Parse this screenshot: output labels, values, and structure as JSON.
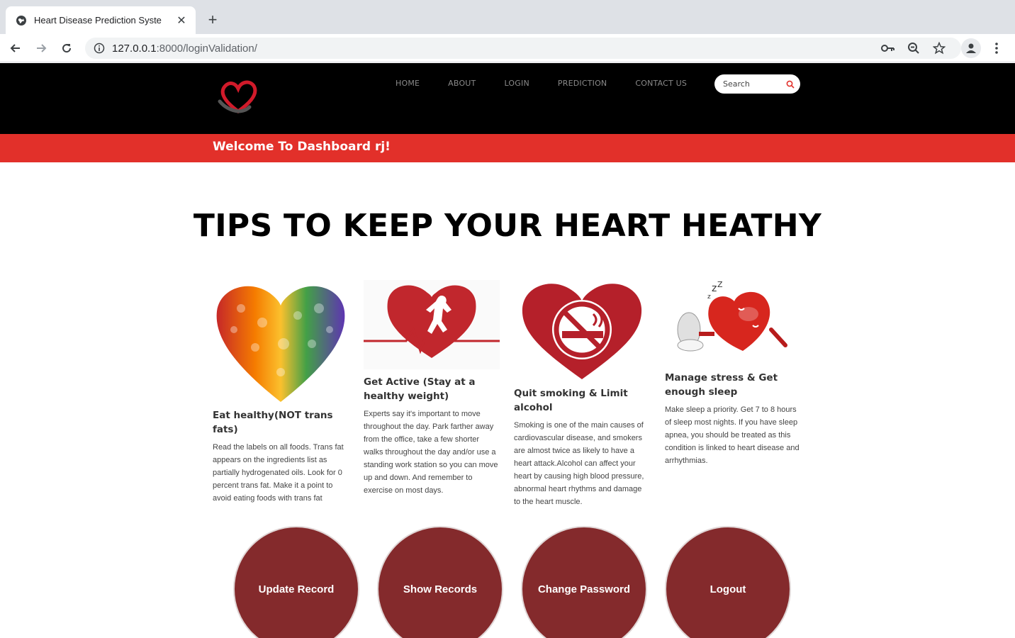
{
  "browser": {
    "tab_title": "Heart Disease Prediction Syste",
    "url_host": "127.0.0.1",
    "url_path": ":8000/loginValidation/"
  },
  "header": {
    "nav": [
      "HOME",
      "ABOUT",
      "LOGIN",
      "PREDICTION",
      "CONTACT US"
    ],
    "search_placeholder": "Search",
    "welcome": "Welcome To Dashboard rj!"
  },
  "main": {
    "title": "TIPS TO KEEP YOUR HEART HEATHY",
    "tips": [
      {
        "title": "Eat healthy(NOT trans fats)",
        "body": "Read the labels on all foods. Trans fat appears on the ingredients list as partially hydrogenated oils. Look for 0 percent trans fat. Make it a point to avoid eating foods with trans fat"
      },
      {
        "title": "Get Active (Stay at a healthy weight)",
        "body": "Experts say it's important to move throughout the day. Park farther away from the office, take a few shorter walks throughout the day and/or use a standing work station so you can move up and down. And remember to exercise on most days."
      },
      {
        "title": "Quit smoking & Limit alcohol",
        "body": "Smoking is one of the main causes of cardiovascular disease, and smokers are almost twice as likely to have a heart attack.Alcohol can affect your heart by causing high blood pressure, abnormal heart rhythms and damage to the heart muscle."
      },
      {
        "title": "Manage stress & Get enough sleep",
        "body": "Make sleep a priority. Get 7 to 8 hours of sleep most nights. If you have sleep apnea, you should be treated as this condition is linked to heart disease and arrhythmias."
      }
    ],
    "actions": [
      "Update Record",
      "Show Records",
      "Change Password",
      "Logout"
    ]
  },
  "colors": {
    "header_bg": "#000000",
    "welcome_bar": "#e2302a",
    "action_button": "#842a2c"
  }
}
